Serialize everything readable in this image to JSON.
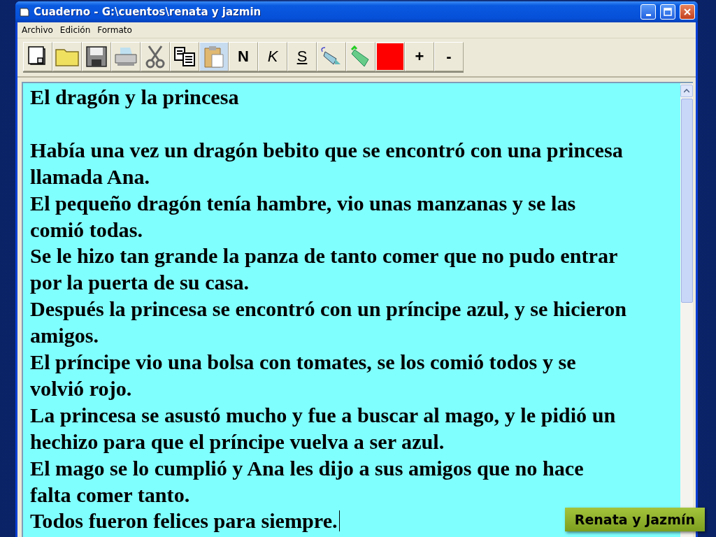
{
  "window": {
    "title": "Cuaderno - G:\\cuentos\\renata y jazmin"
  },
  "menu": [
    "Archivo",
    "Edición",
    "Formato"
  ],
  "toolbar": [
    {
      "kind": "icon",
      "pressed": false
    },
    {
      "kind": "icon",
      "pressed": false
    },
    {
      "kind": "icon",
      "pressed": false
    },
    {
      "kind": "icon",
      "pressed": false
    },
    {
      "kind": "icon",
      "pressed": false
    },
    {
      "kind": "icon",
      "pressed": false
    },
    {
      "kind": "icon",
      "pressed": true
    },
    {
      "kind": "bold",
      "label": "N",
      "pressed": false
    },
    {
      "kind": "italic",
      "label": "K",
      "pressed": false
    },
    {
      "kind": "underline",
      "label": "S",
      "pressed": false
    },
    {
      "kind": "icon",
      "pressed": false
    },
    {
      "kind": "icon",
      "pressed": false
    },
    {
      "kind": "swatch",
      "color": "#ff0000",
      "pressed": false
    },
    {
      "kind": "plain",
      "label": "+",
      "pressed": false
    },
    {
      "kind": "plain",
      "label": "-",
      "pressed": false
    }
  ],
  "document": {
    "heading": "El dragón y la princesa",
    "lines": [
      "Había una vez un dragón bebito que se encontró con una princesa",
      "llamada Ana.",
      "El pequeño dragón tenía hambre, vio unas manzanas y se las",
      "comió todas.",
      "Se le hizo tan grande la panza de tanto comer que no pudo entrar",
      "por la puerta de su casa.",
      "Después la princesa se encontró con un príncipe azul, y se hicieron",
      "amigos.",
      "El príncipe vio una bolsa con tomates, se los comió todos y se",
      "volvió rojo.",
      "La princesa se asustó mucho y fue a buscar al mago, y le pidió un",
      "hechizo para que el príncipe vuelva a ser azul.",
      "El mago se lo cumplió y Ana les dijo a sus amigos que no hace",
      "falta comer tanto.",
      "Todos fueron felices para siempre."
    ]
  },
  "caption": "Renata y Jazmín"
}
